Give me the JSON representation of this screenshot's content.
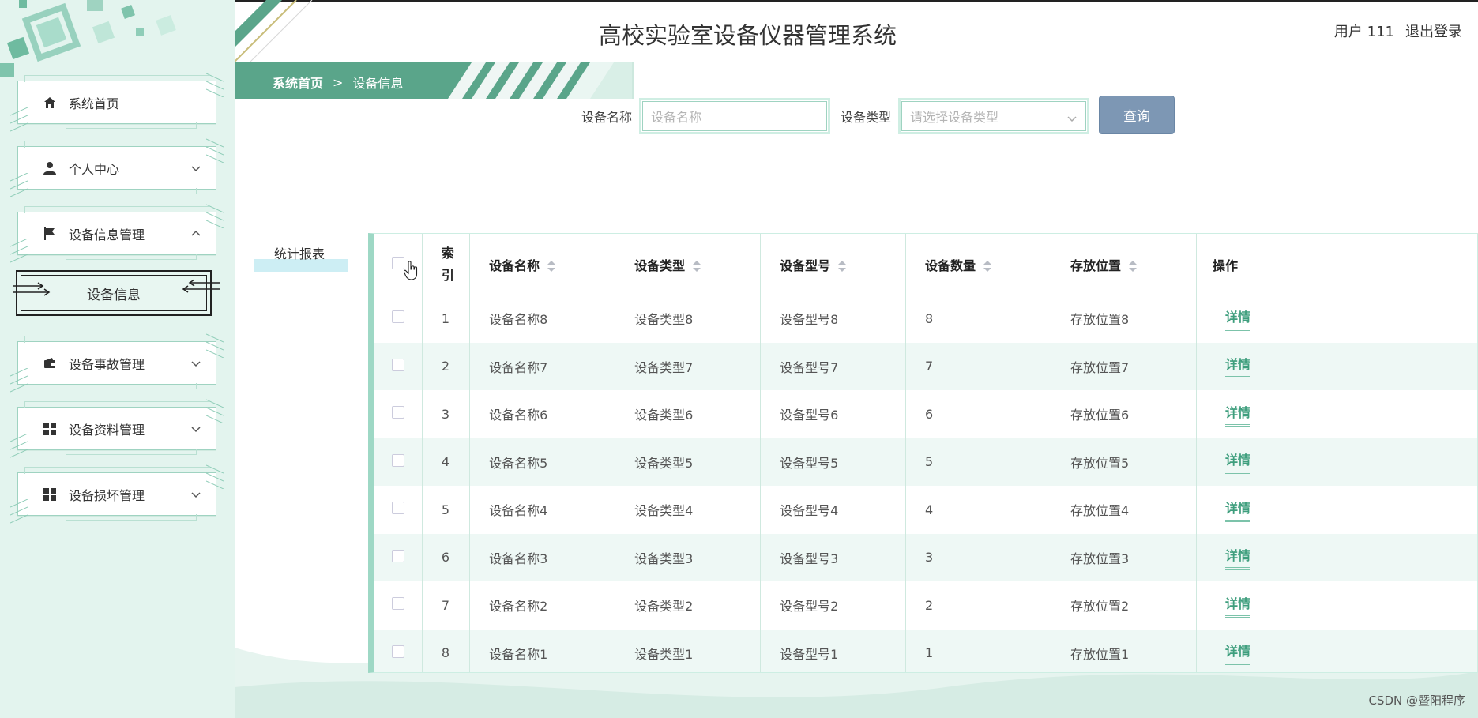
{
  "header": {
    "title": "高校实验室设备仪器管理系统",
    "user_text": "用户 111",
    "logout_label": "退出登录"
  },
  "sidebar": {
    "items": [
      {
        "label": "系统首页",
        "icon": "home-icon"
      },
      {
        "label": "个人中心",
        "icon": "user-icon"
      },
      {
        "label": "设备信息管理",
        "icon": "flag-icon"
      },
      {
        "label": "设备信息",
        "icon": ""
      },
      {
        "label": "设备事故管理",
        "icon": "wallet-icon"
      },
      {
        "label": "设备资料管理",
        "icon": "grid-icon"
      },
      {
        "label": "设备损坏管理",
        "icon": "grid-icon"
      }
    ]
  },
  "breadcrumb": {
    "home": "系统首页",
    "separator": ">",
    "current": "设备信息"
  },
  "search": {
    "name_label": "设备名称",
    "name_placeholder": "设备名称",
    "type_label": "设备类型",
    "type_placeholder": "请选择设备类型",
    "submit_label": "查询"
  },
  "tabs": {
    "stats_label": "统计报表"
  },
  "table": {
    "headers": {
      "index": "索引",
      "name": "设备名称",
      "type": "设备类型",
      "model": "设备型号",
      "qty": "设备数量",
      "location": "存放位置",
      "action": "操作"
    },
    "action_label": "详情",
    "rows": [
      {
        "idx": "1",
        "name": "设备名称8",
        "type": "设备类型8",
        "model": "设备型号8",
        "qty": "8",
        "location": "存放位置8"
      },
      {
        "idx": "2",
        "name": "设备名称7",
        "type": "设备类型7",
        "model": "设备型号7",
        "qty": "7",
        "location": "存放位置7"
      },
      {
        "idx": "3",
        "name": "设备名称6",
        "type": "设备类型6",
        "model": "设备型号6",
        "qty": "6",
        "location": "存放位置6"
      },
      {
        "idx": "4",
        "name": "设备名称5",
        "type": "设备类型5",
        "model": "设备型号5",
        "qty": "5",
        "location": "存放位置5"
      },
      {
        "idx": "5",
        "name": "设备名称4",
        "type": "设备类型4",
        "model": "设备型号4",
        "qty": "4",
        "location": "存放位置4"
      },
      {
        "idx": "6",
        "name": "设备名称3",
        "type": "设备类型3",
        "model": "设备型号3",
        "qty": "3",
        "location": "存放位置3"
      },
      {
        "idx": "7",
        "name": "设备名称2",
        "type": "设备类型2",
        "model": "设备型号2",
        "qty": "2",
        "location": "存放位置2"
      },
      {
        "idx": "8",
        "name": "设备名称1",
        "type": "设备类型1",
        "model": "设备型号1",
        "qty": "1",
        "location": "存放位置1"
      }
    ]
  },
  "footer": {
    "watermark": "CSDN @暨阳程序"
  },
  "colors": {
    "sidebar_bg": "#e3f4ee",
    "accent_green": "#5aa58a",
    "button_blue": "#7d97b4",
    "link_green": "#3e9e7d",
    "row_alt": "#eef8f5"
  }
}
